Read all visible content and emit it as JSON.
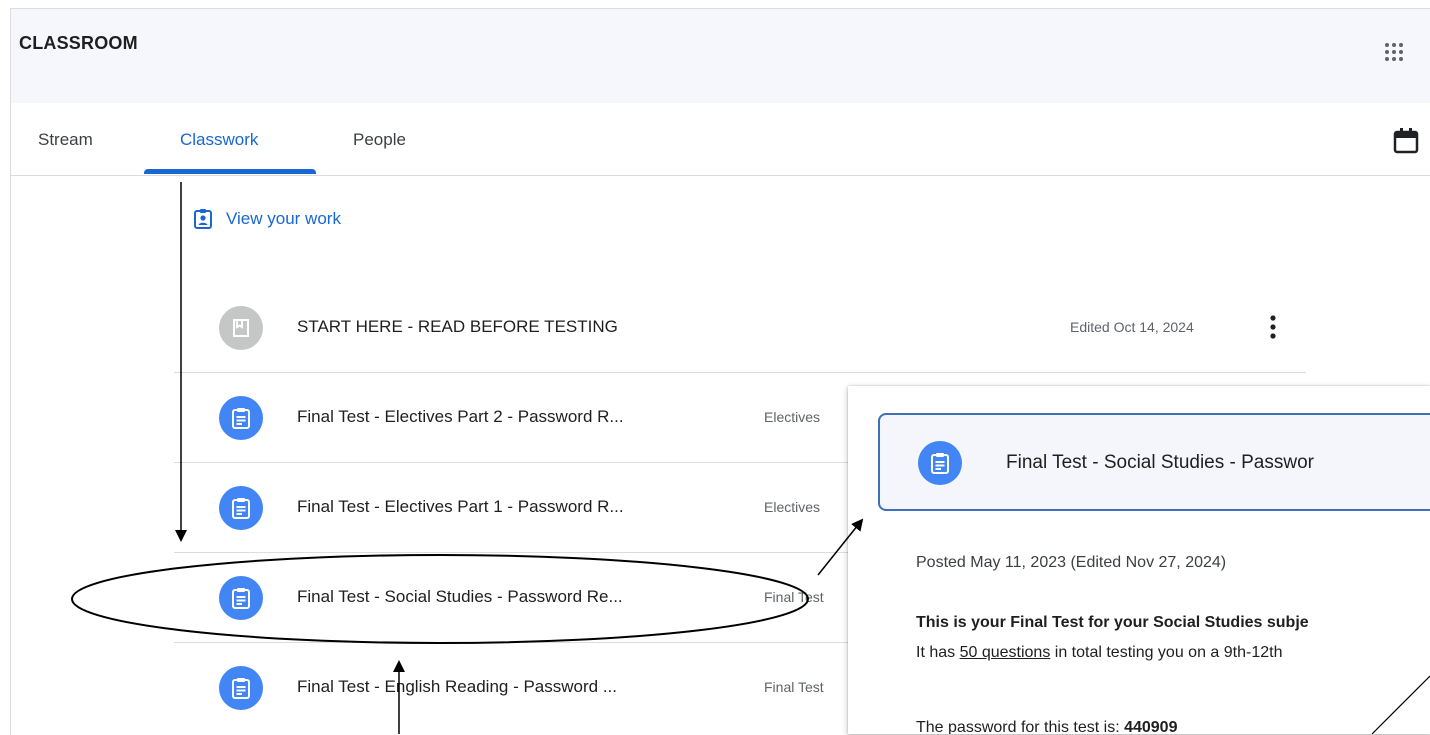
{
  "app": {
    "title": "CLASSROOM"
  },
  "header": {
    "apps_icon": "google-apps-icon"
  },
  "tabs": [
    {
      "label": "Stream",
      "active": false
    },
    {
      "label": "Classwork",
      "active": true
    },
    {
      "label": "People",
      "active": false
    }
  ],
  "toolbar": {
    "calendar_icon": "calendar-icon"
  },
  "view_work": {
    "label": "View your work",
    "icon": "assignment-ind-icon"
  },
  "items": [
    {
      "title": "START HERE - READ BEFORE TESTING",
      "topic": "",
      "edited": "Edited Oct 14, 2024",
      "icon": "material-icon"
    },
    {
      "title": "Final Test - Electives Part 2 - Password R...",
      "topic": "Electives",
      "edited": "",
      "icon": "assignment-icon"
    },
    {
      "title": "Final Test - Electives Part 1 - Password R...",
      "topic": "Electives",
      "edited": "",
      "icon": "assignment-icon"
    },
    {
      "title": "Final Test - Social Studies - Password Re...",
      "topic": "Final Test",
      "edited": "",
      "icon": "assignment-icon"
    },
    {
      "title": "Final Test - English Reading - Password ...",
      "topic": "Final Test",
      "edited": "",
      "icon": "assignment-icon"
    }
  ],
  "popup": {
    "title": "Final Test - Social Studies - Passwor",
    "posted": "Posted May 11, 2023 (Edited Nov 27, 2024)",
    "line1_bold": "This is your Final Test for your Social Studies subje",
    "line2_pre": "It has ",
    "line2_link": "50 questions",
    "line2_post": " in total testing you on a 9th-12th",
    "line3_pre": "The password for this test is: ",
    "line3_bold": "440909"
  },
  "colors": {
    "accent": "#1967d2",
    "assignment_blue": "#4285f4",
    "material_gray": "#c4c7c5",
    "header_bg": "#f5f7fc"
  }
}
